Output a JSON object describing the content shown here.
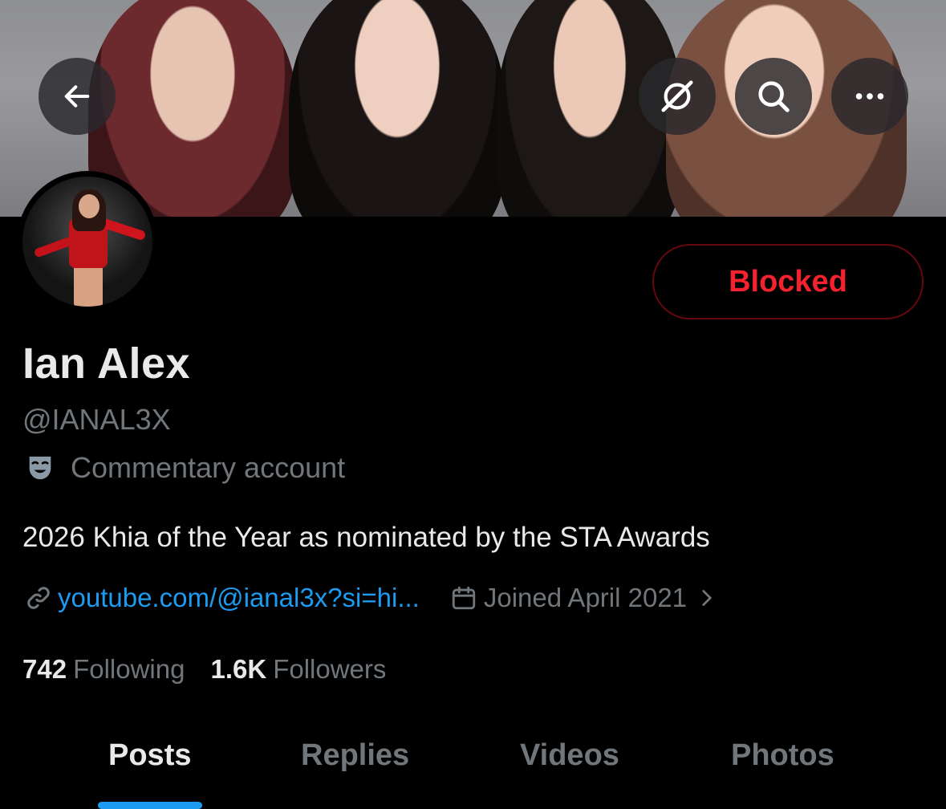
{
  "banner": {
    "back_icon": "arrow-left-icon",
    "grok_icon": "grok-icon",
    "search_icon": "search-icon",
    "more_icon": "more-horizontal-icon"
  },
  "profile": {
    "name": "Ian Alex",
    "handle": "@IANAL3X",
    "account_label": "Commentary account",
    "account_label_icon": "theater-mask-icon",
    "bio": "2026 Khia of the Year as nominated by the STA Awards",
    "link": "youtube.com/@ianal3x?si=hi...",
    "joined": "Joined April 2021",
    "block_button": "Blocked"
  },
  "stats": {
    "following_count": "742",
    "following_label": "Following",
    "followers_count": "1.6K",
    "followers_label": "Followers"
  },
  "tabs": [
    {
      "label": "Posts",
      "active": true
    },
    {
      "label": "Replies",
      "active": false
    },
    {
      "label": "Videos",
      "active": false
    },
    {
      "label": "Photos",
      "active": false
    }
  ],
  "colors": {
    "accent": "#1d9bf0",
    "blocked_red": "#f4212e",
    "muted_text": "#71767b",
    "background": "#000000"
  }
}
